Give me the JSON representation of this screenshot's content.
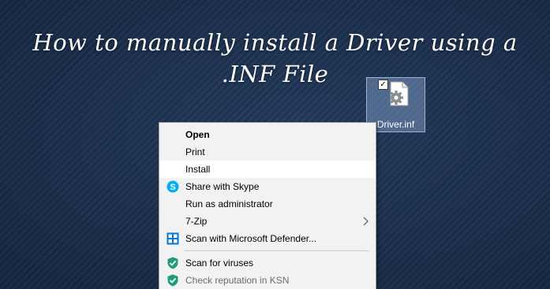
{
  "headline": {
    "line1": "How to manually install a Driver using a",
    "line2": ".INF File"
  },
  "desktop": {
    "file": {
      "name": "Driver.inf",
      "checkbox_mark": "✓",
      "icon": "settings-file-icon"
    }
  },
  "context_menu": {
    "items": [
      {
        "label": "Open",
        "bold": true
      },
      {
        "label": "Print"
      },
      {
        "label": "Install",
        "highlighted": true
      },
      {
        "label": "Share with Skype",
        "icon": "skype-icon"
      },
      {
        "label": "Run as administrator"
      },
      {
        "label": "7-Zip",
        "submenu": true
      },
      {
        "label": "Scan with Microsoft Defender...",
        "icon": "defender-icon"
      },
      {
        "label": "Scan for viruses",
        "icon": "kaspersky-shield-icon"
      },
      {
        "label": "Check reputation in KSN",
        "icon": "kaspersky-shield-icon",
        "disabled": true
      }
    ]
  },
  "colors": {
    "background": "#1b2d47",
    "menu_background": "#f2f2f2",
    "menu_highlight": "#ffffff",
    "skype_blue": "#00aff0",
    "defender_blue": "#0078d7",
    "kaspersky_green": "#1f9d7a"
  }
}
